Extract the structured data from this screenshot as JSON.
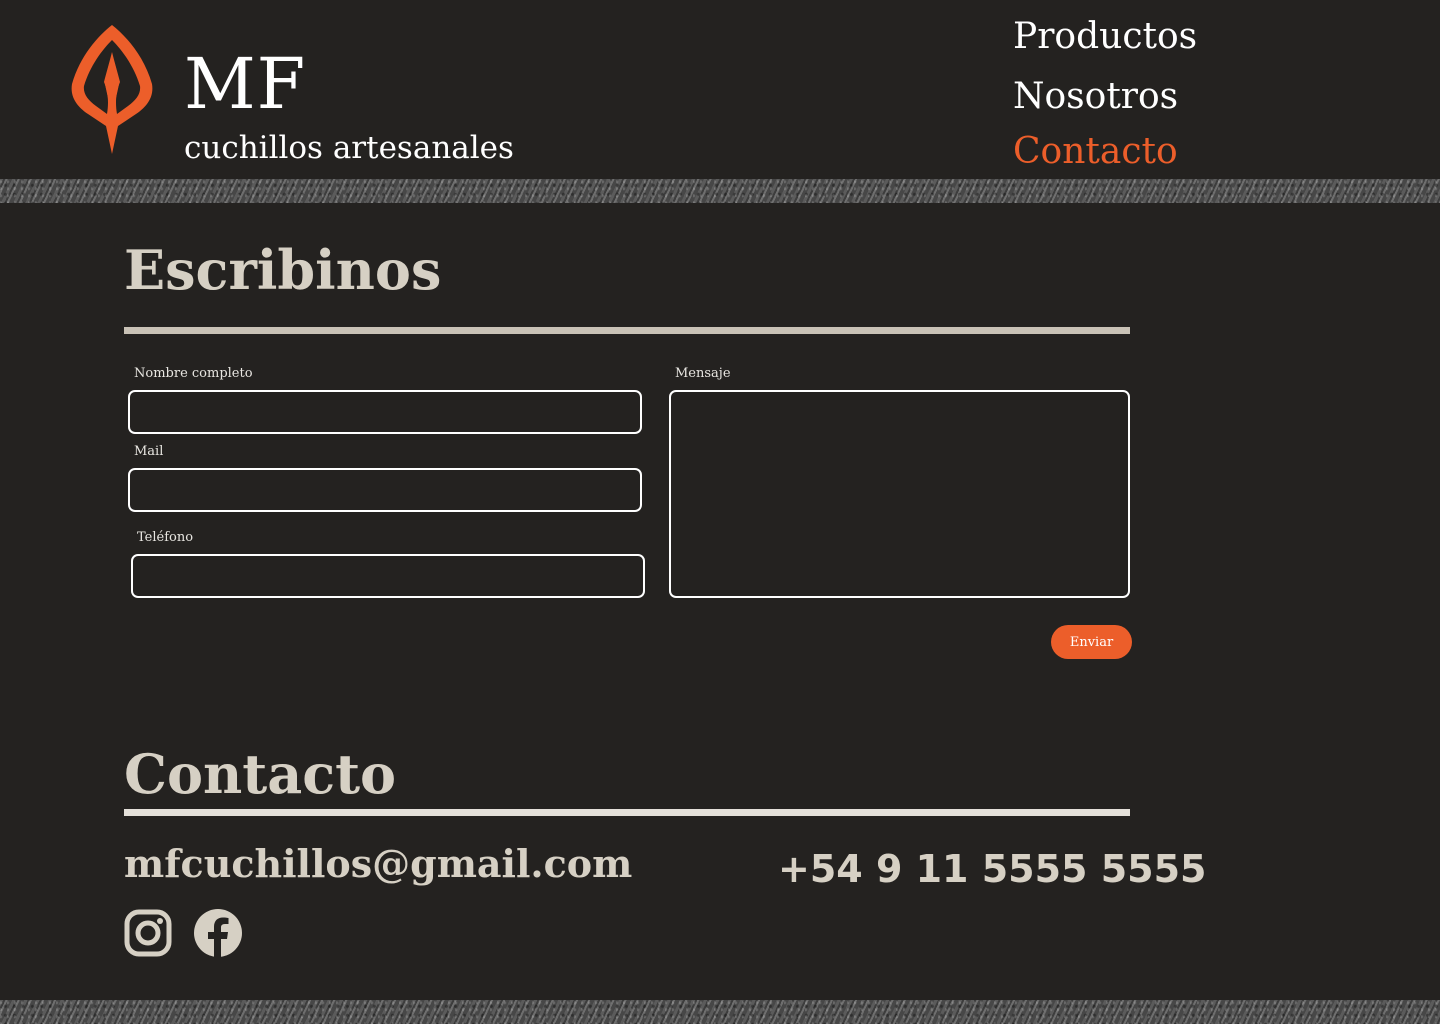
{
  "brand": {
    "title": "MF",
    "subtitle": "cuchillos artesanales",
    "accent": "#ec5e2a",
    "logo_icon": "knife-shield-logo"
  },
  "nav": {
    "items": [
      {
        "label": "Productos",
        "active": false
      },
      {
        "label": "Nosotros",
        "active": false
      },
      {
        "label": "Contacto",
        "active": true
      }
    ]
  },
  "form_section": {
    "title": "Escribinos",
    "fields": {
      "name": {
        "label": "Nombre completo",
        "value": ""
      },
      "mail": {
        "label": "Mail",
        "value": ""
      },
      "phone": {
        "label": "Teléfono",
        "value": ""
      },
      "message": {
        "label": "Mensaje",
        "value": ""
      }
    },
    "submit_label": "Enviar"
  },
  "contact_section": {
    "title": "Contacto",
    "email": "mfcuchillos@gmail.com",
    "phone": "+54 9 11 5555 5555",
    "social_icons": [
      "instagram-icon",
      "facebook-icon"
    ]
  },
  "colors": {
    "background": "#242220",
    "text_light": "#d6d0c4",
    "accent": "#ec5e2a"
  }
}
